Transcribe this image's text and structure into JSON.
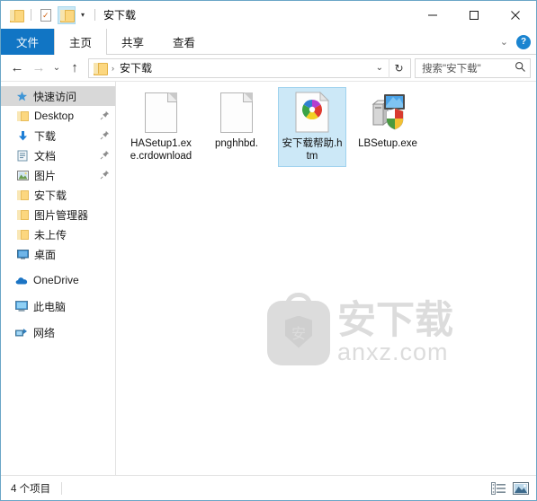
{
  "window": {
    "title": "安下载",
    "quick_access_toolbar": [
      {
        "name": "folder-icon",
        "label": ""
      },
      {
        "name": "properties-icon",
        "label": ""
      },
      {
        "name": "new-folder-icon",
        "label": ""
      },
      {
        "name": "customize-caret",
        "label": "▾"
      }
    ],
    "controls": {
      "minimize": "—",
      "maximize": "□",
      "close": "✕"
    }
  },
  "ribbon": {
    "tabs": [
      {
        "label": "文件",
        "active": true
      },
      {
        "label": "主页",
        "active": false
      },
      {
        "label": "共享",
        "active": false
      },
      {
        "label": "查看",
        "active": false
      }
    ],
    "collapse_caret": "⌄",
    "help_label": "?"
  },
  "address_bar": {
    "back": "←",
    "forward": "→",
    "recent": "⌄",
    "up": "↑",
    "breadcrumb_separator": "›",
    "breadcrumb": "安下载",
    "path_caret": "⌄",
    "refresh": "↻",
    "search_placeholder": "搜索\"安下载\"",
    "search_icon": "⌕"
  },
  "sidebar": {
    "items": [
      {
        "label": "快速访问",
        "icon": "star-icon",
        "selected": true,
        "pinned": false,
        "level": 0
      },
      {
        "label": "Desktop",
        "icon": "folder-icon",
        "selected": false,
        "pinned": true,
        "level": 1
      },
      {
        "label": "下载",
        "icon": "download-icon",
        "selected": false,
        "pinned": true,
        "level": 1
      },
      {
        "label": "文档",
        "icon": "documents-icon",
        "selected": false,
        "pinned": true,
        "level": 1
      },
      {
        "label": "图片",
        "icon": "pictures-icon",
        "selected": false,
        "pinned": true,
        "level": 1
      },
      {
        "label": "安下载",
        "icon": "folder-icon",
        "selected": false,
        "pinned": false,
        "level": 1
      },
      {
        "label": "图片管理器",
        "icon": "folder-icon",
        "selected": false,
        "pinned": false,
        "level": 1
      },
      {
        "label": "未上传",
        "icon": "folder-icon",
        "selected": false,
        "pinned": false,
        "level": 1
      },
      {
        "label": "桌面",
        "icon": "desktop-icon",
        "selected": false,
        "pinned": false,
        "level": 1
      },
      {
        "label": "OneDrive",
        "icon": "onedrive-cloud-icon",
        "selected": false,
        "pinned": false,
        "level": 0
      },
      {
        "label": "此电脑",
        "icon": "this-pc-icon",
        "selected": false,
        "pinned": false,
        "level": 0
      },
      {
        "label": "网络",
        "icon": "network-icon",
        "selected": false,
        "pinned": false,
        "level": 0
      }
    ],
    "pin_glyph": "📌"
  },
  "files": [
    {
      "name": "HASetup1.exe.crdownload",
      "icon": "generic-file-icon",
      "selected": false
    },
    {
      "name": "pnghhbd.",
      "icon": "generic-file-icon",
      "selected": false
    },
    {
      "name": "安下载帮助.htm",
      "icon": "chrome-html-icon",
      "selected": true
    },
    {
      "name": "LBSetup.exe",
      "icon": "setup-installer-icon",
      "selected": false
    }
  ],
  "watermark": {
    "chinese": "安下载",
    "domain": "anxz.com",
    "logo_char": "安"
  },
  "status_bar": {
    "item_count": "4 个项目",
    "view_details_icon": "details-view-icon",
    "view_large_icons_icon": "large-icons-view-icon"
  },
  "colors": {
    "accent": "#1175c4",
    "selection_bg": "#cce8f7",
    "selection_border": "#9fd2ee",
    "window_border": "#6ba6c7",
    "sidebar_selected": "#d8d8d8",
    "folder_yellow": "#fcd77f"
  }
}
